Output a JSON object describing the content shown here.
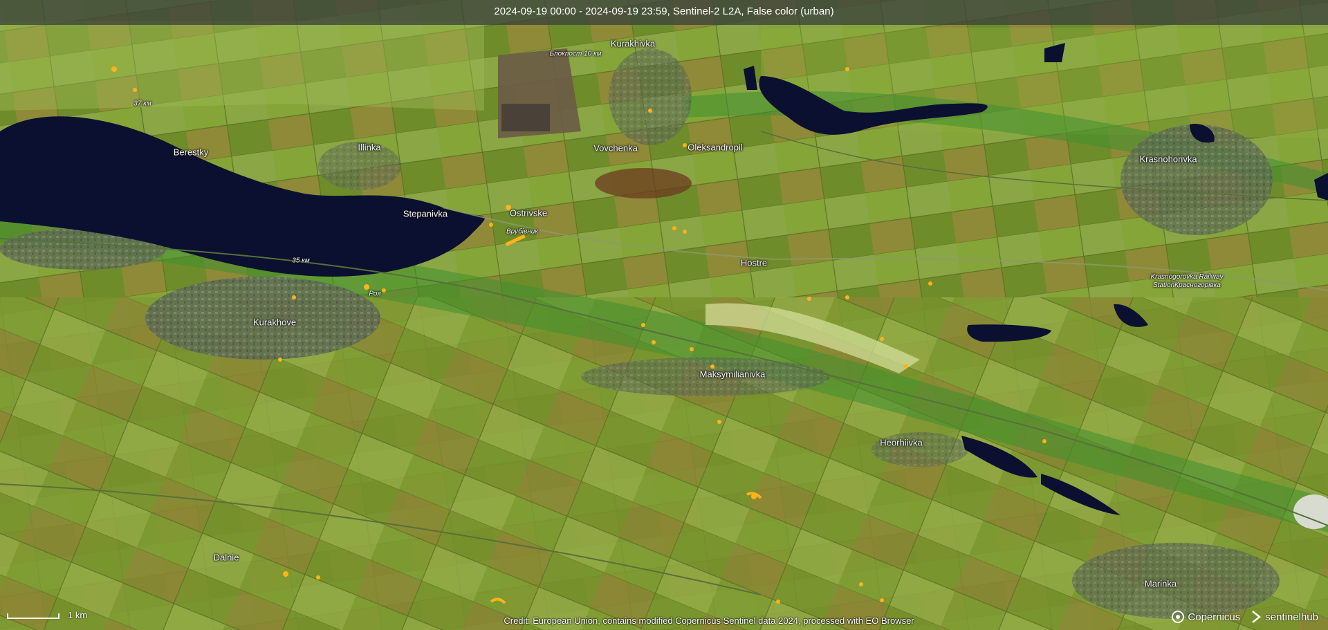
{
  "header": {
    "title": "2024-09-19 00:00 - 2024-09-19 23:59, Sentinel-2 L2A, False color (urban)"
  },
  "places": {
    "kurakhivka": "Kurakhivka",
    "blokpost": "Блокпост 10 км",
    "km37": "37 км",
    "berestky": "Berestky",
    "illinka": "Illinka",
    "vovchenka": "Vovchenka",
    "oleksandropil": "Oleksandropil",
    "krasnohorivka": "Krasnohorivka",
    "stepanivka": "Stepanivka",
    "ostrivske": "Ostrivske",
    "vrubivnyk": "Врубівник",
    "km35": "35 км",
    "hostre": "Hostre",
    "roia": "Роя",
    "kurakhove": "Kurakhove",
    "station": "Krasnogorovka Railway StationКрасногорівка",
    "maksymilianivka": "Maksymilianivka",
    "heorhiivka": "Heorhiivka",
    "dalnie": "Dalnie",
    "marinka": "Marinka"
  },
  "scale": {
    "label": "1 km"
  },
  "credit": "Credit: European Union, contains modified Copernicus Sentinel data 2024, processed with EO Browser",
  "logos": {
    "copernicus": "Copernicus",
    "sentinelhub": "sentinelhub"
  },
  "colors": {
    "field_green": "#7c9a30",
    "water": "#0b1030",
    "fire": "#ffb21a",
    "urban": "#5e6a58"
  }
}
